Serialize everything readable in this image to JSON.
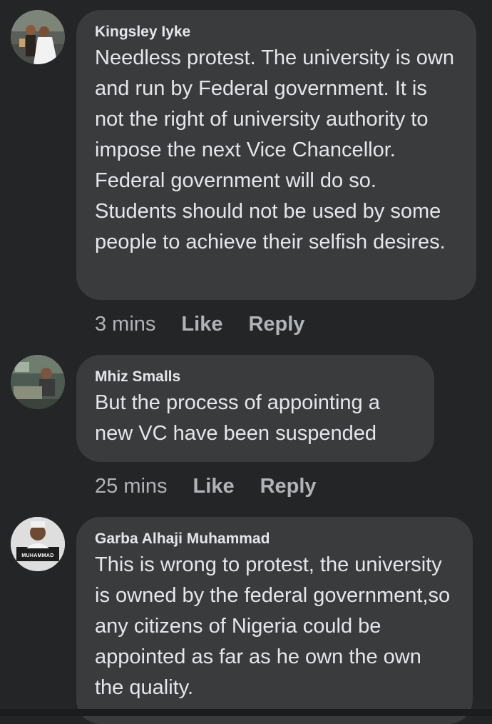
{
  "comments": [
    {
      "author": "Kingsley Iyke",
      "text": "Needless protest. The university is own and run by Federal government. It is not the right of university authority to impose the next Vice Chancellor. Federal government will do so. Students should not be used by some people to achieve their selfish desires.",
      "time": "3 mins",
      "like": "Like",
      "reply": "Reply",
      "avatar_icon": "wedding-photo-avatar"
    },
    {
      "author": "Mhiz Smalls",
      "text": "But the process of appointing a new VC have been suspended",
      "time": "25 mins",
      "like": "Like",
      "reply": "Reply",
      "avatar_icon": "lab-photo-avatar"
    },
    {
      "author": "Garba Alhaji Muhammad",
      "text": "This is wrong to protest, the university is owned by the federal government,so any citizens of Nigeria could be appointed as far as he own the own the quality.",
      "avatar_icon": "profile-photo-avatar",
      "avatar_caption": "MUHAMMAD"
    }
  ],
  "colors": {
    "background": "#242526",
    "bubble": "#3a3b3c",
    "text": "#e4e6eb",
    "secondary_text": "#b0b3b8"
  }
}
